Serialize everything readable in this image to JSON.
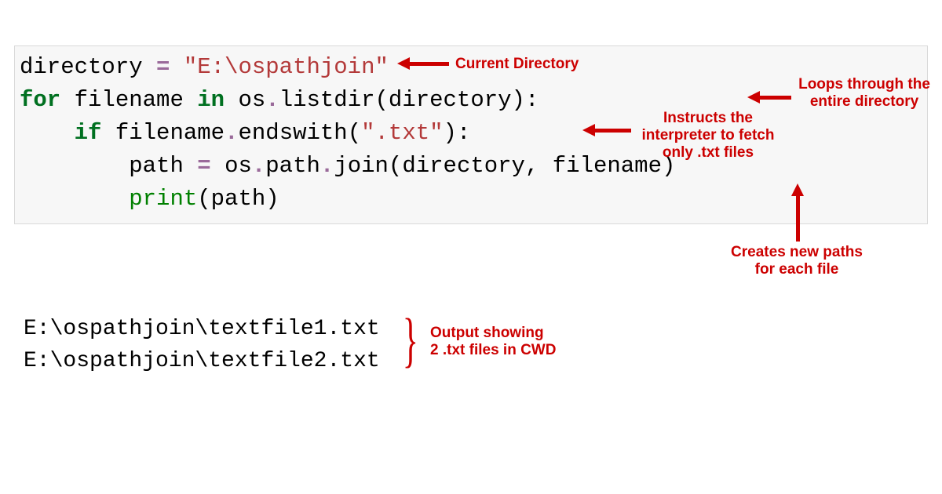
{
  "code": {
    "line1": {
      "var": "directory ",
      "op": "= ",
      "str": "\"E:\\ospathjoin\""
    },
    "line2": {
      "kw1": "for",
      "t1": " filename ",
      "kw2": "in",
      "t2": " os",
      "dot1": ".",
      "t3": "listdir(directory):"
    },
    "line3": {
      "indent": "    ",
      "kw": "if",
      "t1": " filename",
      "dot": ".",
      "t2": "endswith(",
      "str": "\".txt\"",
      "t3": "):"
    },
    "line4": {
      "indent": "        ",
      "t1": "path ",
      "op": "= ",
      "t2": "os",
      "dot1": ".",
      "t3": "path",
      "dot2": ".",
      "t4": "join(directory, filename)"
    },
    "line5": {
      "indent": "        ",
      "call": "print",
      "t1": "(path)"
    }
  },
  "output": {
    "line1": "E:\\ospathjoin\\textfile1.txt",
    "line2": "E:\\ospathjoin\\textfile2.txt"
  },
  "annotations": {
    "a1": "Current Directory",
    "a2_l1": "Loops through the",
    "a2_l2": "entire directory",
    "a3_l1": "Instructs the",
    "a3_l2": "interpreter to fetch",
    "a3_l3": "only .txt files",
    "a4_l1": "Creates new paths",
    "a4_l2": "for each file",
    "a5_l1": "Output showing",
    "a5_l2": "2 .txt files in CWD"
  }
}
